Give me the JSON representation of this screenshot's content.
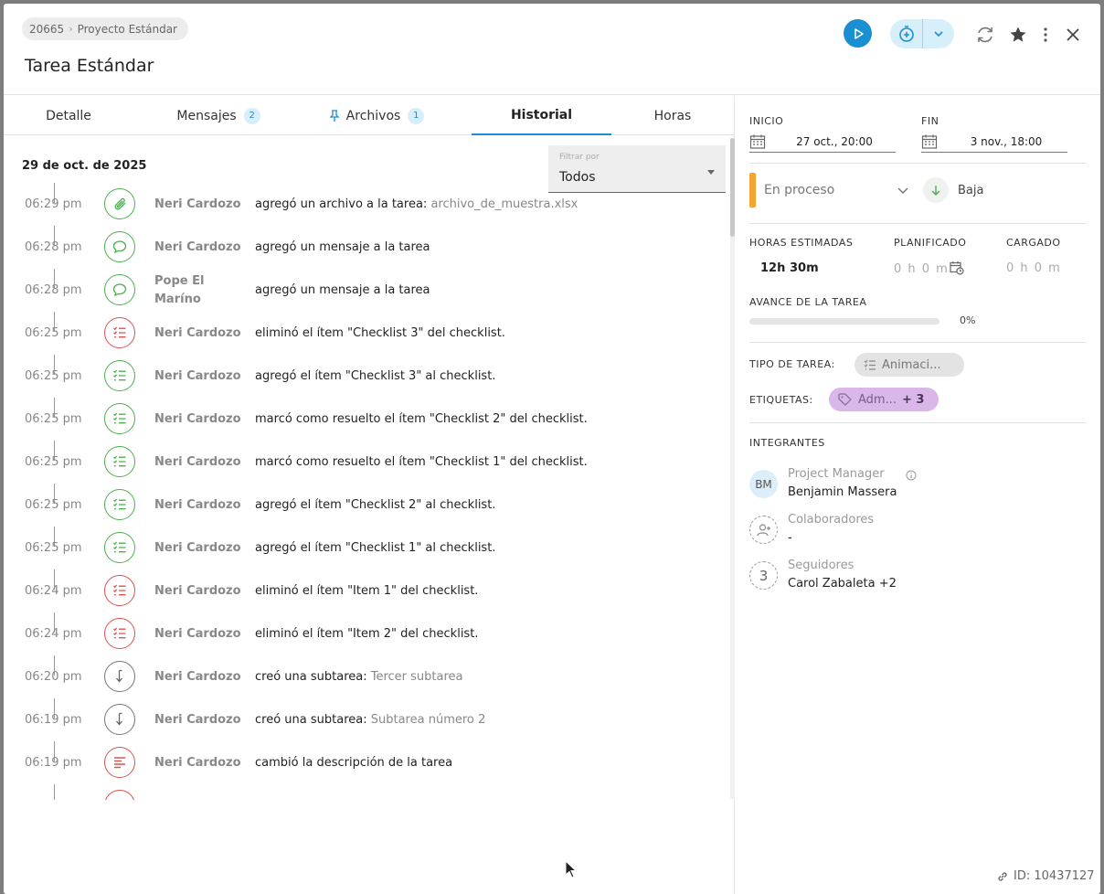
{
  "header": {
    "breadcrumb": {
      "project_id": "20665",
      "project_name": "Proyecto Estándar"
    },
    "title": "Tarea Estándar",
    "icons": [
      "play-icon",
      "timer-add-icon",
      "chevron-down-icon",
      "refresh-icon",
      "star-icon",
      "more-vertical-icon",
      "close-icon"
    ]
  },
  "tabs": [
    {
      "label": "Detalle"
    },
    {
      "label": "Mensajes",
      "count": "2"
    },
    {
      "label": "Archivos",
      "count": "1"
    },
    {
      "label": "Historial"
    },
    {
      "label": "Horas"
    }
  ],
  "history": {
    "date": "29 de oct. de 2025",
    "filter": {
      "label": "Filtrar por",
      "value": "Todos"
    },
    "entries": [
      {
        "time": "06:29 pm",
        "user": "Neri Cardozo",
        "action": "agregó un archivo a la tarea:",
        "object": "archivo_de_muestra.xlsx",
        "icon": "paperclip-icon",
        "color": "green"
      },
      {
        "time": "06:28 pm",
        "user": "Neri Cardozo",
        "action": "agregó un mensaje a la tarea",
        "object": "",
        "icon": "message-icon",
        "color": "green"
      },
      {
        "time": "06:28 pm",
        "user": "Pope El Maríno",
        "action": "agregó un mensaje a la tarea",
        "object": "",
        "icon": "message-icon",
        "color": "green"
      },
      {
        "time": "06:25 pm",
        "user": "Neri Cardozo",
        "action": "eliminó el ítem \"Checklist 3\" del checklist.",
        "object": "",
        "icon": "checklist-icon",
        "color": "red"
      },
      {
        "time": "06:25 pm",
        "user": "Neri Cardozo",
        "action": "agregó el ítem \"Checklist 3\" al checklist.",
        "object": "",
        "icon": "checklist-icon",
        "color": "green"
      },
      {
        "time": "06:25 pm",
        "user": "Neri Cardozo",
        "action": "marcó como resuelto el ítem \"Checklist 2\" del checklist.",
        "object": "",
        "icon": "checklist-icon",
        "color": "green"
      },
      {
        "time": "06:25 pm",
        "user": "Neri Cardozo",
        "action": "marcó como resuelto el ítem \"Checklist 1\" del checklist.",
        "object": "",
        "icon": "checklist-icon",
        "color": "green"
      },
      {
        "time": "06:25 pm",
        "user": "Neri Cardozo",
        "action": "agregó el ítem \"Checklist 2\" al checklist.",
        "object": "",
        "icon": "checklist-icon",
        "color": "green"
      },
      {
        "time": "06:25 pm",
        "user": "Neri Cardozo",
        "action": "agregó el ítem \"Checklist 1\" al checklist.",
        "object": "",
        "icon": "checklist-icon",
        "color": "green"
      },
      {
        "time": "06:24 pm",
        "user": "Neri Cardozo",
        "action": "eliminó el ítem \"Item 1\" del checklist.",
        "object": "",
        "icon": "checklist-icon",
        "color": "red"
      },
      {
        "time": "06:24 pm",
        "user": "Neri Cardozo",
        "action": "eliminó el ítem \"Item 2\" del checklist.",
        "object": "",
        "icon": "checklist-icon",
        "color": "red"
      },
      {
        "time": "06:20 pm",
        "user": "Neri Cardozo",
        "action": "creó una subtarea:",
        "object": "Tercer subtarea",
        "icon": "subtask-arrow-icon",
        "color": "grey"
      },
      {
        "time": "06:19 pm",
        "user": "Neri Cardozo",
        "action": "creó una subtarea:",
        "object": "Subtarea número 2",
        "icon": "subtask-arrow-icon",
        "color": "grey"
      },
      {
        "time": "06:19 pm",
        "user": "Neri Cardozo",
        "action": "cambió la descripción de la tarea",
        "object": "",
        "icon": "description-icon",
        "color": "red"
      }
    ]
  },
  "details": {
    "start": {
      "label": "INICIO",
      "value": "27 oct., 20:00"
    },
    "end": {
      "label": "FIN",
      "value": "3 nov., 18:00"
    },
    "status": {
      "value": "En proceso",
      "color": "#f3a532"
    },
    "priority": {
      "value": "Baja"
    },
    "estimated": {
      "label": "HORAS ESTIMADAS",
      "hours": "12h",
      "minutes": "30m"
    },
    "planned": {
      "label": "PLANIFICADO",
      "value": "0 h 0 m"
    },
    "loaded": {
      "label": "CARGADO",
      "value": "0 h 0 m"
    },
    "progress": {
      "label": "AVANCE DE LA TAREA",
      "value": "0%",
      "fraction": 0
    },
    "task_type": {
      "label": "TIPO DE TAREA:",
      "value": "Animaci..."
    },
    "tags": {
      "label": "ETIQUETAS:",
      "value": "Adm...",
      "extra": "+ 3"
    },
    "members": {
      "label": "INTEGRANTES",
      "pm": {
        "role": "Project Manager",
        "name": "Benjamin Massera",
        "initials": "BM"
      },
      "collaborators": {
        "role": "Colaboradores",
        "name": "-"
      },
      "followers": {
        "role": "Seguidores",
        "name": "Carol Zabaleta +2",
        "count": "3"
      }
    },
    "id_text": "ID: 10437127"
  },
  "colors": {
    "accent": "#1a8fd1",
    "green": "#4caf50",
    "red": "#d9534f",
    "status": "#f3a532"
  }
}
